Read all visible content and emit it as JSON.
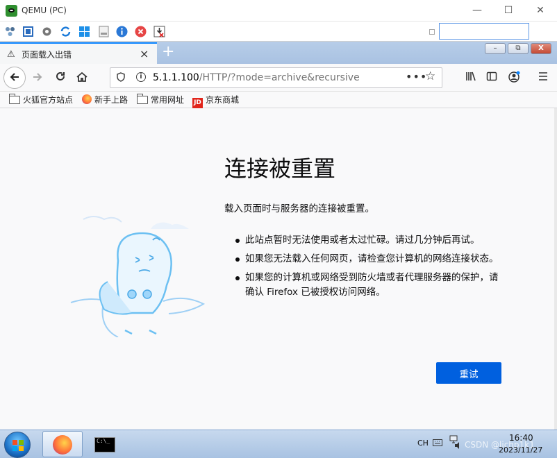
{
  "window": {
    "title": "QEMU (PC)"
  },
  "tab": {
    "label": "页面载入出错",
    "close": "×",
    "new_tab": "+"
  },
  "vm_buttons": {
    "minimize": "–",
    "restore": "⧉",
    "close": "X"
  },
  "url": {
    "host": "5.1.1.100",
    "path": "/HTTP/?mode=archive&recursive",
    "more": "•••"
  },
  "bookmarks": [
    {
      "label": "火狐官方站点",
      "icon": "folder-icon"
    },
    {
      "label": "新手上路",
      "icon": "firefox-icon"
    },
    {
      "label": "常用网址",
      "icon": "folder-icon"
    },
    {
      "label": "京东商城",
      "icon": "jd-icon",
      "badge": "JD"
    }
  ],
  "error": {
    "title": "连接被重置",
    "description": "载入页面时与服务器的连接被重置。",
    "bullets": [
      "此站点暂时无法使用或者太过忙碌。请过几分钟后再试。",
      "如果您无法载入任何网页，请检查您计算机的网络连接状态。",
      "如果您的计算机或网络受到防火墙或者代理服务器的保护，请确认 Firefox 已被授权访问网络。"
    ],
    "retry_label": "重试"
  },
  "taskbar": {
    "cmd_text": "C:\\_",
    "lang": "CH",
    "time": "16:40",
    "date": "2023/11/27",
    "watermark": "CSDN @lichp1k1"
  },
  "colors": {
    "accent": "#0060df",
    "tab_accent": "#0a84ff"
  }
}
